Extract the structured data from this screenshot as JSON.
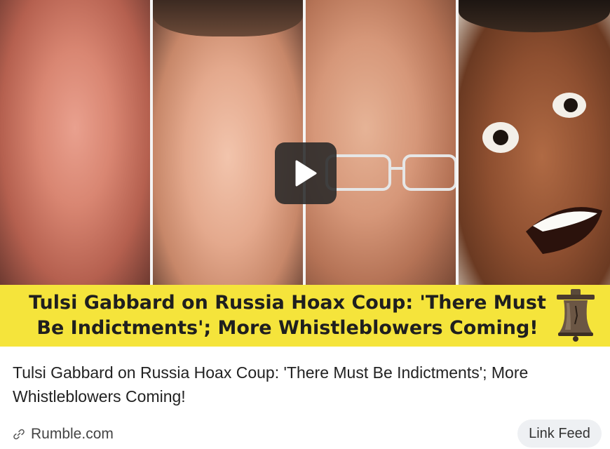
{
  "media": {
    "banner_line1": "Tulsi Gabbard on Russia Hoax Coup: 'There Must",
    "banner_line2": "Be Indictments'; More Whistleblowers Coming!",
    "play_icon": "play-icon",
    "logo_icon": "liberty-bell-icon"
  },
  "post": {
    "title": "Tulsi Gabbard on Russia Hoax Coup: 'There Must Be Indictments'; More Whistleblowers Coming!",
    "source": "Rumble.com",
    "source_icon": "link-icon",
    "tag": "Link Feed"
  },
  "colors": {
    "banner": "#f5e43b",
    "tag_bg": "#eef0f3"
  }
}
